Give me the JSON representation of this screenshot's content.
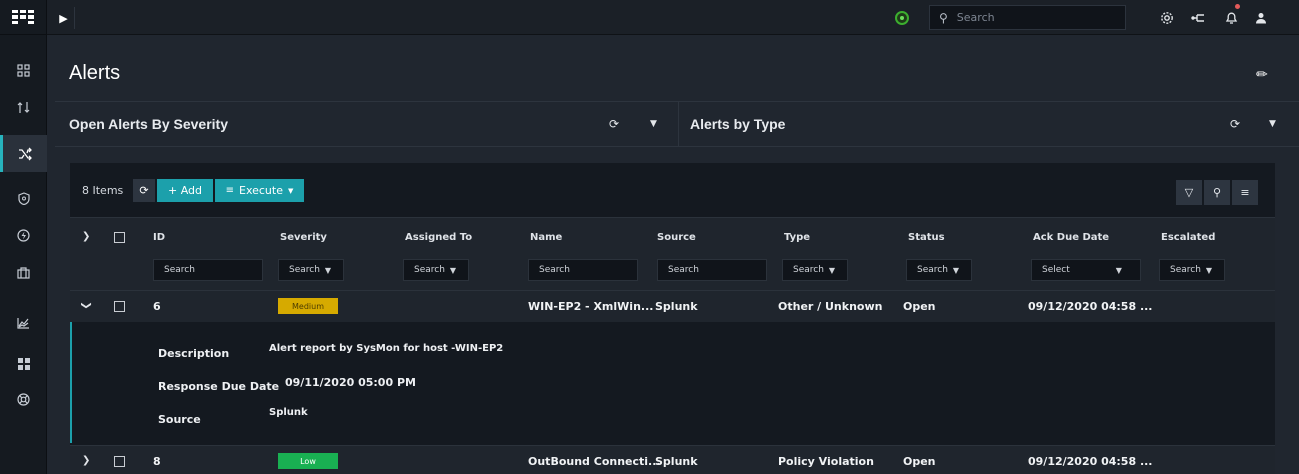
{
  "topbar": {
    "search_placeholder": "Search"
  },
  "page": {
    "title": "Alerts"
  },
  "widgets": [
    {
      "title": "Open Alerts By Severity"
    },
    {
      "title": "Alerts by Type"
    }
  ],
  "grid": {
    "items_count": "8 Items",
    "add_label": "+ Add",
    "execute_label": "Execute",
    "columns": [
      {
        "label": "ID",
        "filter": "Search"
      },
      {
        "label": "Severity",
        "filter": "Search"
      },
      {
        "label": "Assigned To",
        "filter": "Search"
      },
      {
        "label": "Name",
        "filter": "Search"
      },
      {
        "label": "Source",
        "filter": "Search"
      },
      {
        "label": "Type",
        "filter": "Search"
      },
      {
        "label": "Status",
        "filter": "Search"
      },
      {
        "label": "Ack Due Date",
        "filter": "Select"
      },
      {
        "label": "Escalated",
        "filter": "Search"
      }
    ],
    "rows": [
      {
        "id": "6",
        "severity": "Medium",
        "severity_color": "#d6aa00",
        "name": "WIN-EP2 - XmlWin...",
        "source": "Splunk",
        "type": "Other / Unknown",
        "status": "Open",
        "ack_due": "09/12/2020 04:58 ..."
      },
      {
        "id": "8",
        "severity": "Low",
        "severity_color": "#19b052",
        "name": "OutBound Connecti...",
        "source": "Splunk",
        "type": "Policy Violation",
        "status": "Open",
        "ack_due": "09/12/2020 04:58 ..."
      }
    ],
    "detail": {
      "description_label": "Description",
      "description_value": "Alert report by SysMon for host -WIN-EP2",
      "response_label": "Response Due Date",
      "response_value": "09/11/2020 05:00 PM",
      "source_label": "Source",
      "source_value": "Splunk"
    }
  },
  "colors": {
    "accent": "#1ca0ab",
    "background": "#20262f"
  }
}
